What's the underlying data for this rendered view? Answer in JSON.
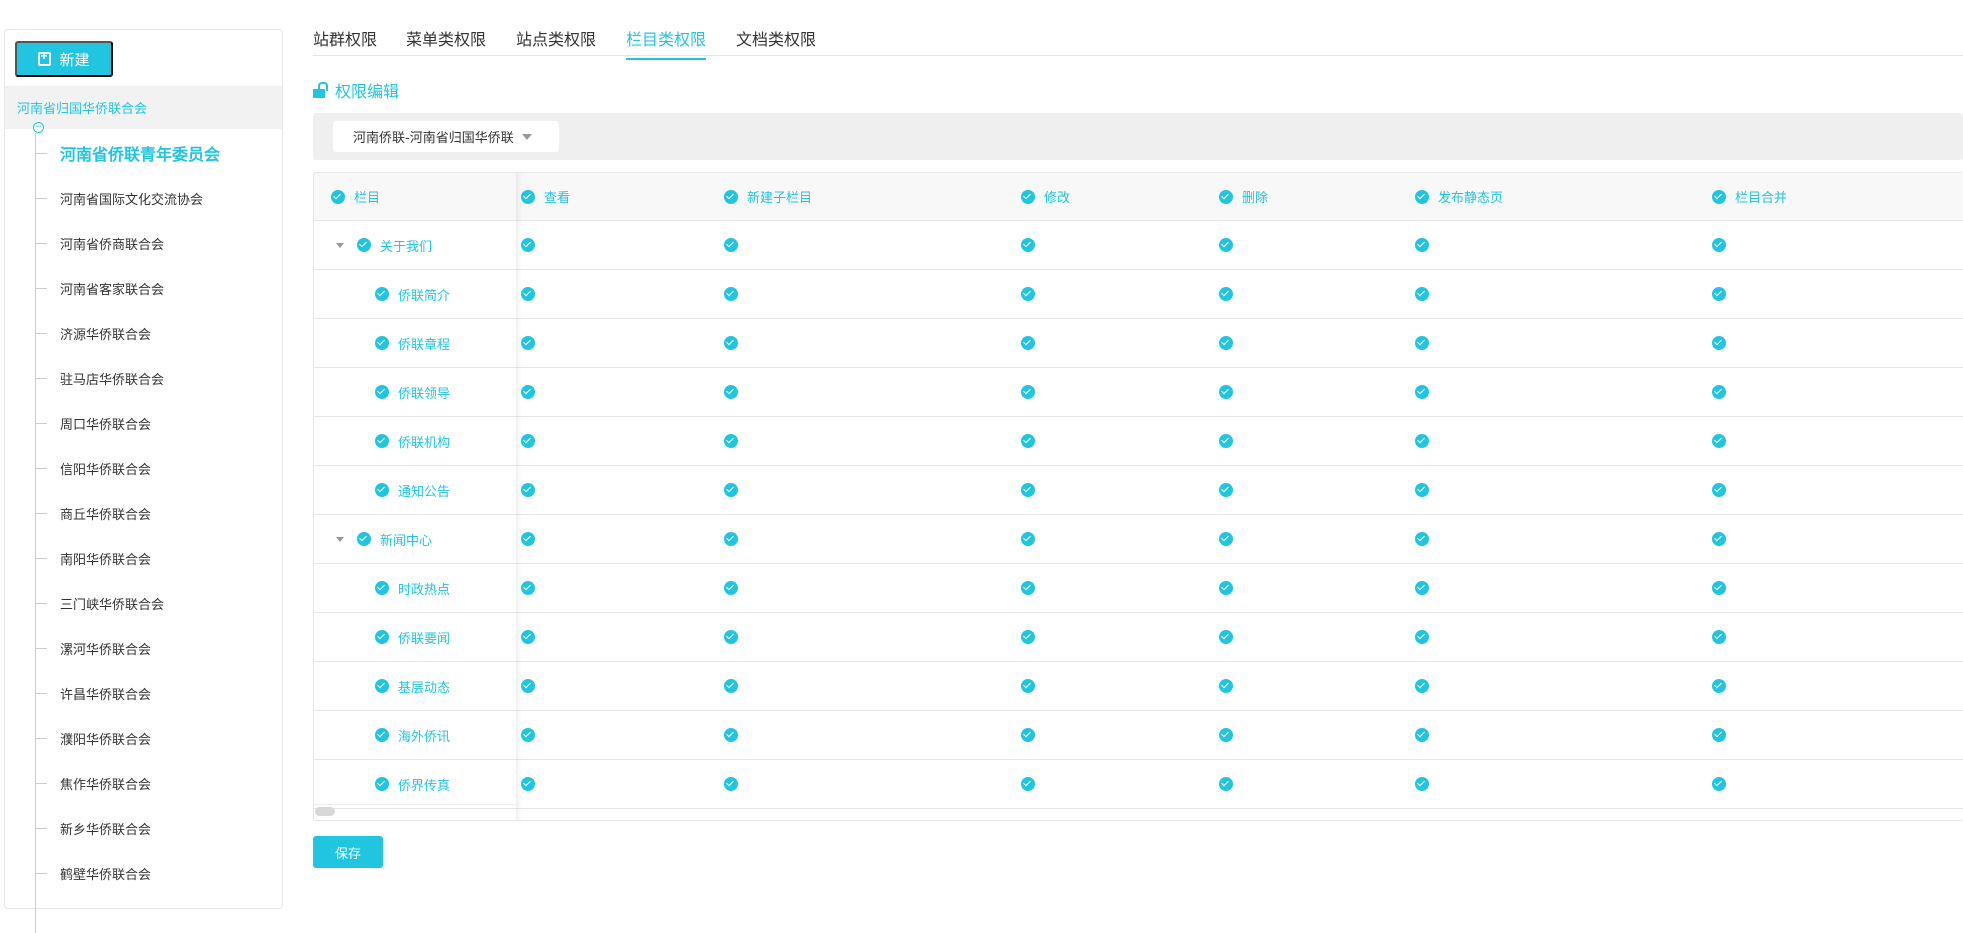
{
  "sidebar": {
    "new_label": "新建",
    "root": "河南省归国华侨联合会",
    "collapse_symbol": "−",
    "items": [
      "河南省侨联青年委员会",
      "河南省国际文化交流协会",
      "河南省侨商联合会",
      "河南省客家联合会",
      "济源华侨联合会",
      "驻马店华侨联合会",
      "周口华侨联合会",
      "信阳华侨联合会",
      "商丘华侨联合会",
      "南阳华侨联合会",
      "三门峡华侨联合会",
      "漯河华侨联合会",
      "许昌华侨联合会",
      "濮阳华侨联合会",
      "焦作华侨联合会",
      "新乡华侨联合会",
      "鹤壁华侨联合会"
    ],
    "active_index": 0
  },
  "tabs": [
    "站群权限",
    "菜单类权限",
    "站点类权限",
    "栏目类权限",
    "文档类权限"
  ],
  "active_tab": 3,
  "section_title": "权限编辑",
  "site_select": "河南侨联-河南省归国华侨联",
  "table": {
    "columns": [
      "栏目",
      "查看",
      "新建子栏目",
      "修改",
      "删除",
      "发布静态页",
      "栏目合并"
    ],
    "rows": [
      {
        "name": "关于我们",
        "level": 0,
        "expandable": true
      },
      {
        "name": "侨联简介",
        "level": 1
      },
      {
        "name": "侨联章程",
        "level": 1
      },
      {
        "name": "侨联领导",
        "level": 1
      },
      {
        "name": "侨联机构",
        "level": 1
      },
      {
        "name": "通知公告",
        "level": 1
      },
      {
        "name": "新闻中心",
        "level": 0,
        "expandable": true
      },
      {
        "name": "时政热点",
        "level": 1
      },
      {
        "name": "侨联要闻",
        "level": 1
      },
      {
        "name": "基层动态",
        "level": 1
      },
      {
        "name": "海外侨讯",
        "level": 1
      },
      {
        "name": "侨界传真",
        "level": 1
      }
    ],
    "all_checked": true
  },
  "save_label": "保存",
  "colors": {
    "accent": "#21c5e0"
  }
}
